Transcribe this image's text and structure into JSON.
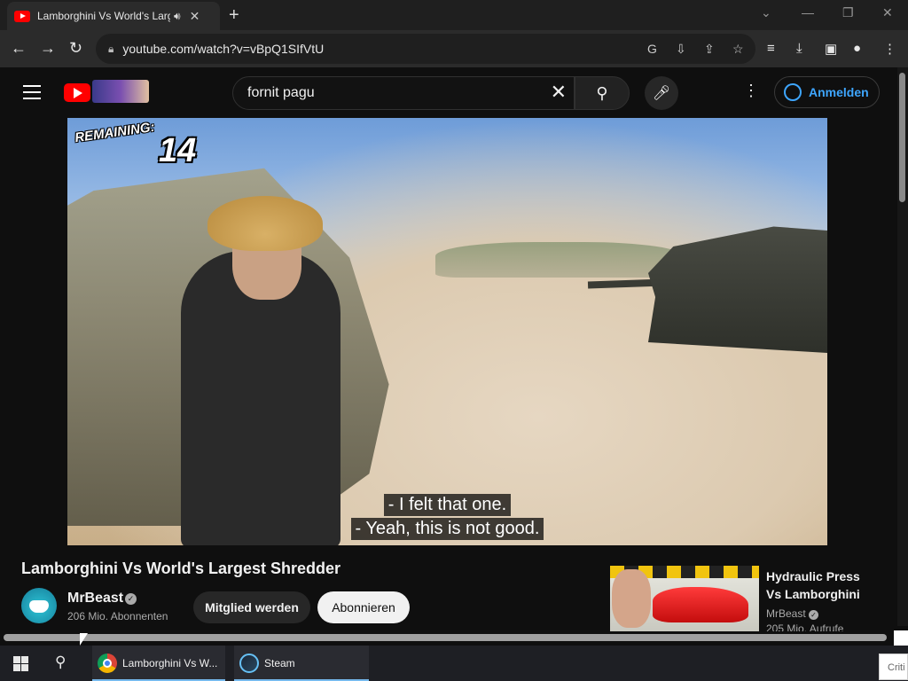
{
  "browser": {
    "tab_title": "Lamborghini Vs World's Larg",
    "address_url": "youtube.com/watch?v=vBpQ1SIfVtU"
  },
  "youtube": {
    "search_query": "fornit pagu",
    "sign_in_label": "Anmelden"
  },
  "player": {
    "overlay_remaining_label": "REMAINING:",
    "overlay_remaining_count": "14",
    "subtitles": [
      "- I felt that one.",
      "- Yeah, this is not good."
    ]
  },
  "video": {
    "title": "Lamborghini Vs World's Largest Shredder",
    "channel_name": "MrBeast",
    "subscriber_count": "206 Mio. Abonnenten",
    "join_label": "Mitglied werden",
    "subscribe_label": "Abonnieren"
  },
  "recommendation": {
    "title": "Hydraulic Press Vs Lamborghini",
    "channel": "MrBeast",
    "views": "205 Mio. Aufrufe"
  },
  "taskbar": {
    "items": [
      {
        "label": "Lamborghini Vs W..."
      },
      {
        "label": "Steam"
      }
    ],
    "tray_popup": "Criti"
  },
  "colors": {
    "youtube_red": "#ff0000",
    "link_blue": "#3ea6ff",
    "background": "#0f0f0f"
  }
}
